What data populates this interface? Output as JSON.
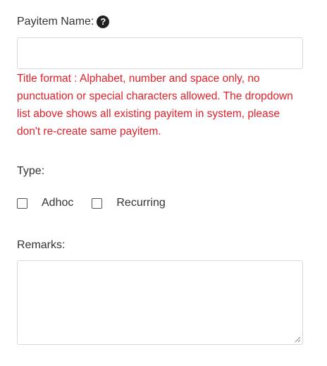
{
  "form": {
    "payitem_label": "Payitem Name:",
    "payitem_value": "",
    "payitem_placeholder": "",
    "error_message": "Title format : Alphabet, number and space only, no punctuation or special characters allowed. The dropdown list above shows all existing payitem in system, please don't re-create same payitem.",
    "type_label": "Type:",
    "type_options": [
      {
        "label": "Adhoc",
        "checked": false
      },
      {
        "label": "Recurring",
        "checked": false
      }
    ],
    "remarks_label": "Remarks:",
    "remarks_value": ""
  },
  "icons": {
    "help": "question-circle-icon",
    "help_glyph": "?"
  },
  "colors": {
    "error": "#e0202a",
    "text": "#333333",
    "border": "#d9d9d9"
  }
}
